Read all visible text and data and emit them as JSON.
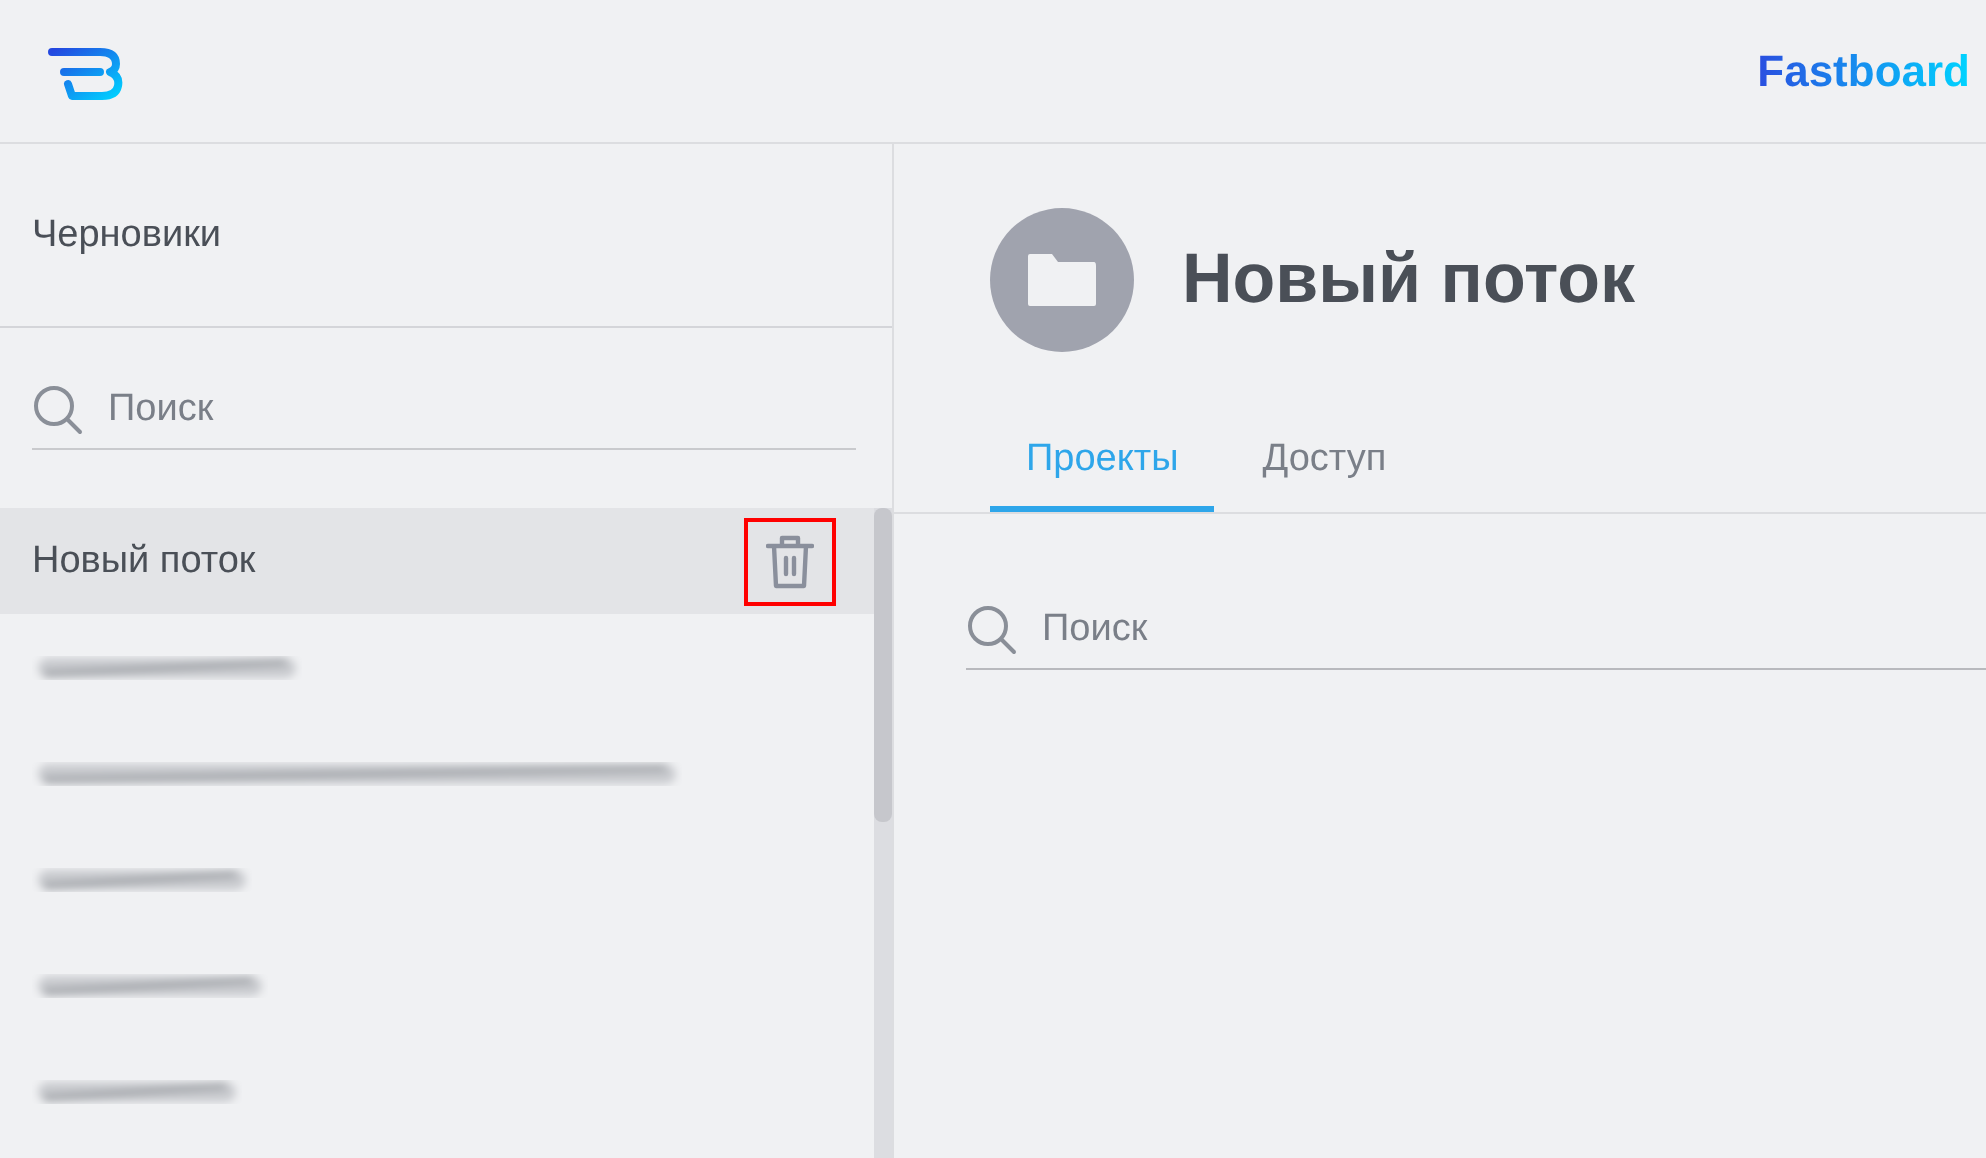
{
  "header": {
    "brand": "Fastboard"
  },
  "sidebar": {
    "title": "Черновики",
    "search": {
      "placeholder": "Поиск"
    },
    "items": [
      {
        "kind": "text",
        "label": "Новый поток",
        "selected": true,
        "delete_highlighted": true
      },
      {
        "kind": "redacted",
        "selected": false
      },
      {
        "kind": "redacted",
        "selected": false
      },
      {
        "kind": "redacted",
        "selected": false
      },
      {
        "kind": "redacted",
        "selected": false
      },
      {
        "kind": "redacted",
        "selected": false
      }
    ]
  },
  "main": {
    "title": "Новый поток",
    "tabs": [
      {
        "label": "Проекты",
        "selected": true
      },
      {
        "label": "Доступ",
        "selected": false
      }
    ],
    "search": {
      "placeholder": "Поиск"
    }
  }
}
